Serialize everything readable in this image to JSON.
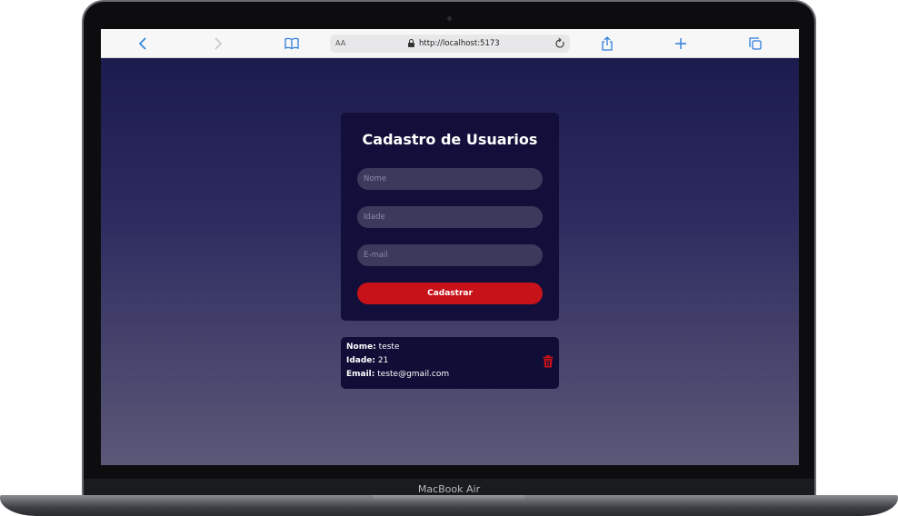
{
  "device": {
    "label": "MacBook Air"
  },
  "browser": {
    "reader_label": "AA",
    "url": "http://localhost:5173",
    "icons": [
      "back-icon",
      "forward-icon",
      "bookmarks-icon",
      "reload-icon",
      "share-icon",
      "new-tab-icon",
      "tabs-icon"
    ]
  },
  "form": {
    "title": "Cadastro de Usuarios",
    "name_placeholder": "Nome",
    "age_placeholder": "Idade",
    "email_placeholder": "E-mail",
    "submit_label": "Cadastrar"
  },
  "users": [
    {
      "name_label": "Nome:",
      "name": "teste",
      "age_label": "Idade:",
      "age": "21",
      "email_label": "Email:",
      "email": "teste@gmail.com"
    }
  ],
  "colors": {
    "page_top": "#1c1b4e",
    "page_bottom": "#5b5878",
    "card_bg": "#12103a",
    "input_bg": "#3c3a5c",
    "accent": "#c8121a",
    "browser_blue": "#2f7ddb"
  }
}
